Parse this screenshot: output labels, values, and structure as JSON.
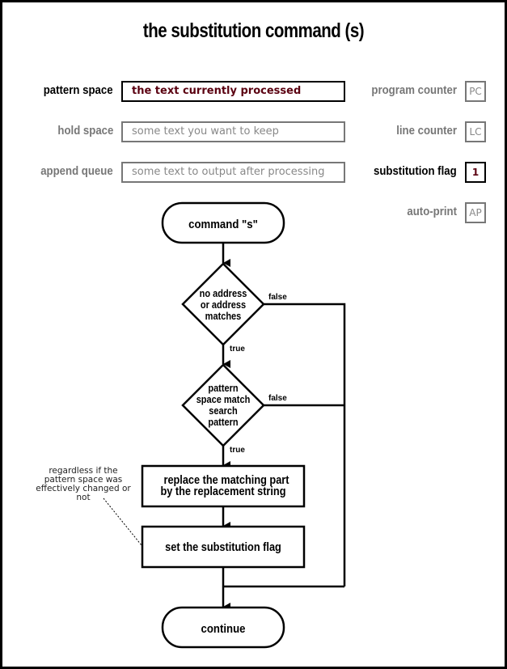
{
  "title": "the substitution command (s)",
  "buffers": [
    {
      "label": "pattern space",
      "value": "the text currently processed",
      "active": true
    },
    {
      "label": "hold space",
      "value": "some text you want to keep",
      "active": false
    },
    {
      "label": "append queue",
      "value": "some text to output after processing",
      "active": false
    }
  ],
  "registers": [
    {
      "label": "program counter",
      "value": "PC",
      "active": false
    },
    {
      "label": "line counter",
      "value": "LC",
      "active": false
    },
    {
      "label": "substitution flag",
      "value": "1",
      "active": true
    },
    {
      "label": "auto-print",
      "value": "AP",
      "active": false
    }
  ],
  "flowchart": {
    "start": "command \"s\"",
    "decision1": [
      "no address",
      "or address",
      "matches"
    ],
    "decision2": [
      "pattern",
      "space match",
      "search",
      "pattern"
    ],
    "process1": [
      "replace the matching part",
      "by the replacement string"
    ],
    "process2": "set the substitution flag",
    "end": "continue",
    "true_label": "true",
    "false_label": "false"
  },
  "note": "regardless if the pattern space was effectively changed or not",
  "colors": {
    "active_value": "#5a0010",
    "inactive": "#777777",
    "line": "#000000"
  }
}
